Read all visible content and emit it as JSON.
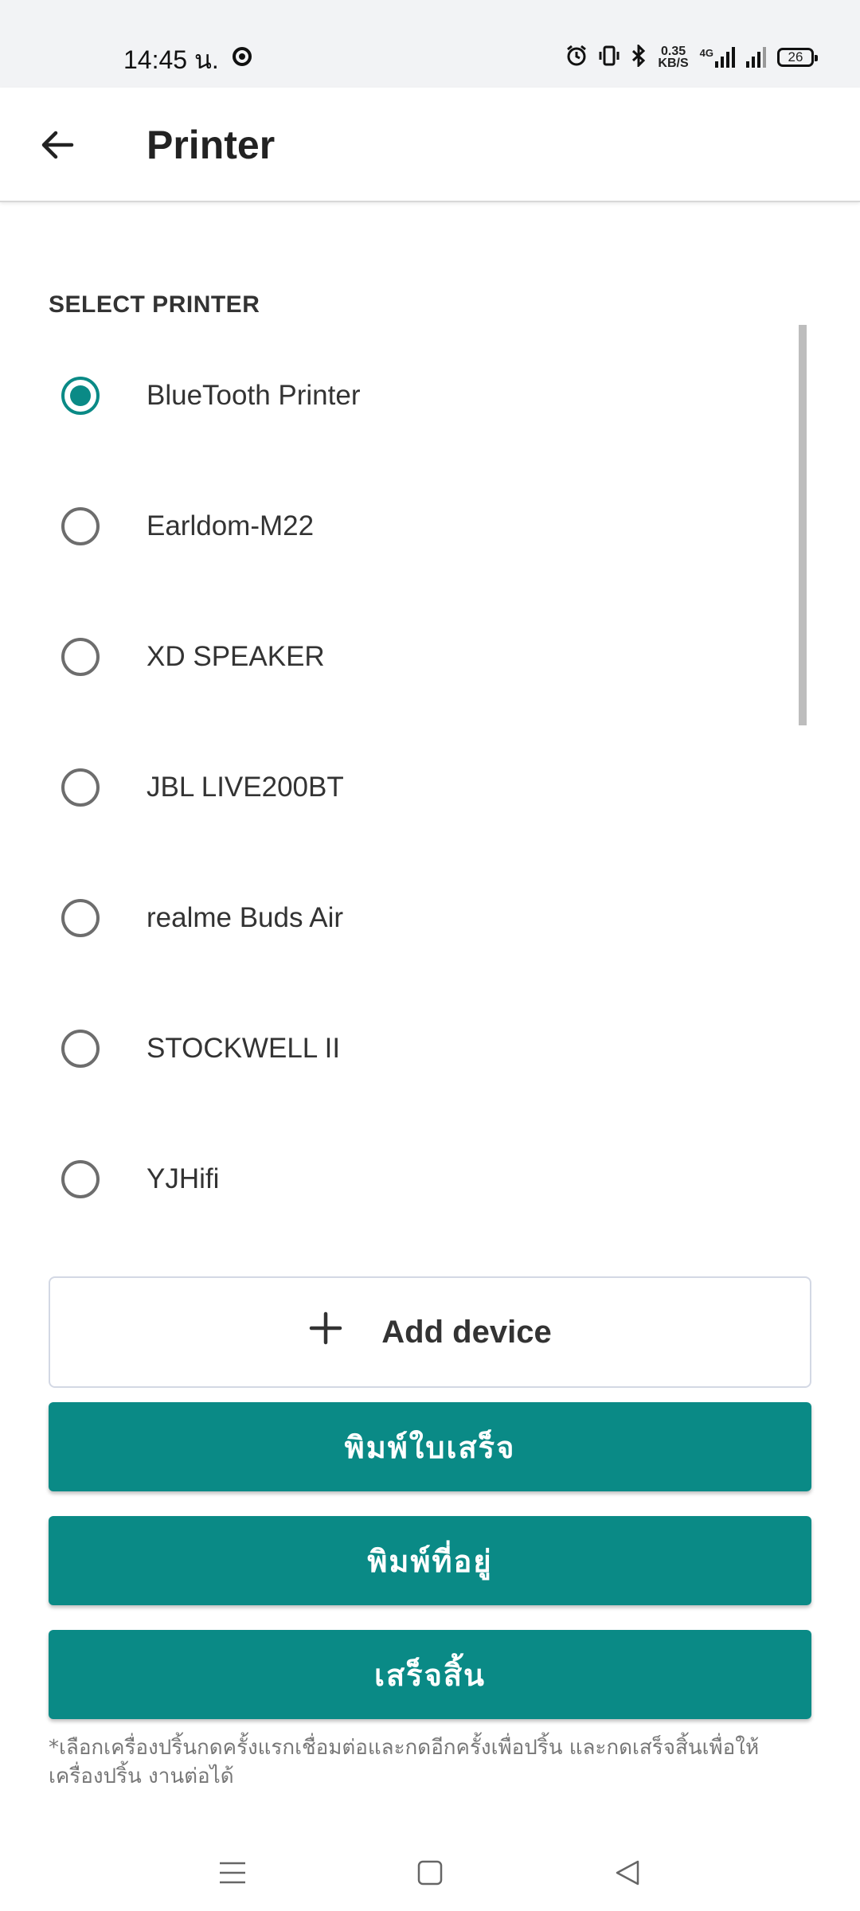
{
  "status_bar": {
    "time": "14:45 น.",
    "net_speed_value": "0.35",
    "net_speed_unit": "KB/S",
    "network_type": "4G",
    "battery": "26",
    "icons": [
      "alarm-icon",
      "vibrate-icon",
      "bluetooth-icon",
      "signal-icon",
      "signal-icon",
      "battery-icon"
    ]
  },
  "app_bar": {
    "title": "Printer",
    "back_icon": "arrow-left-icon"
  },
  "printers": {
    "section_label": "SELECT PRINTER",
    "selected_index": 0,
    "items": [
      {
        "name": "BlueTooth Printer",
        "selected": true
      },
      {
        "name": "Earldom-M22",
        "selected": false
      },
      {
        "name": "XD SPEAKER",
        "selected": false
      },
      {
        "name": "JBL LIVE200BT",
        "selected": false
      },
      {
        "name": "realme Buds Air",
        "selected": false
      },
      {
        "name": "STOCKWELL II",
        "selected": false
      },
      {
        "name": "YJHifi",
        "selected": false
      }
    ]
  },
  "actions": {
    "add_device_label": "Add device",
    "print_receipt_label": "พิมพ์ใบเสร็จ",
    "print_address_label": "พิมพ์ที่อยู่",
    "done_label": "เสร็จสิ้น"
  },
  "footnote": "*เลือกเครื่องปริ้นกดครั้งแรกเชื่อมต่อและกดอีกครั้งเพื่อปริ้น และกดเสร็จสิ้นเพื่อให้เครื่องปริ้น งานต่อได้",
  "colors": {
    "accent": "#0a8a86",
    "status_bar_bg": "#f2f3f5",
    "text_primary": "#222222",
    "radio_unchecked": "#6d6d6d"
  }
}
